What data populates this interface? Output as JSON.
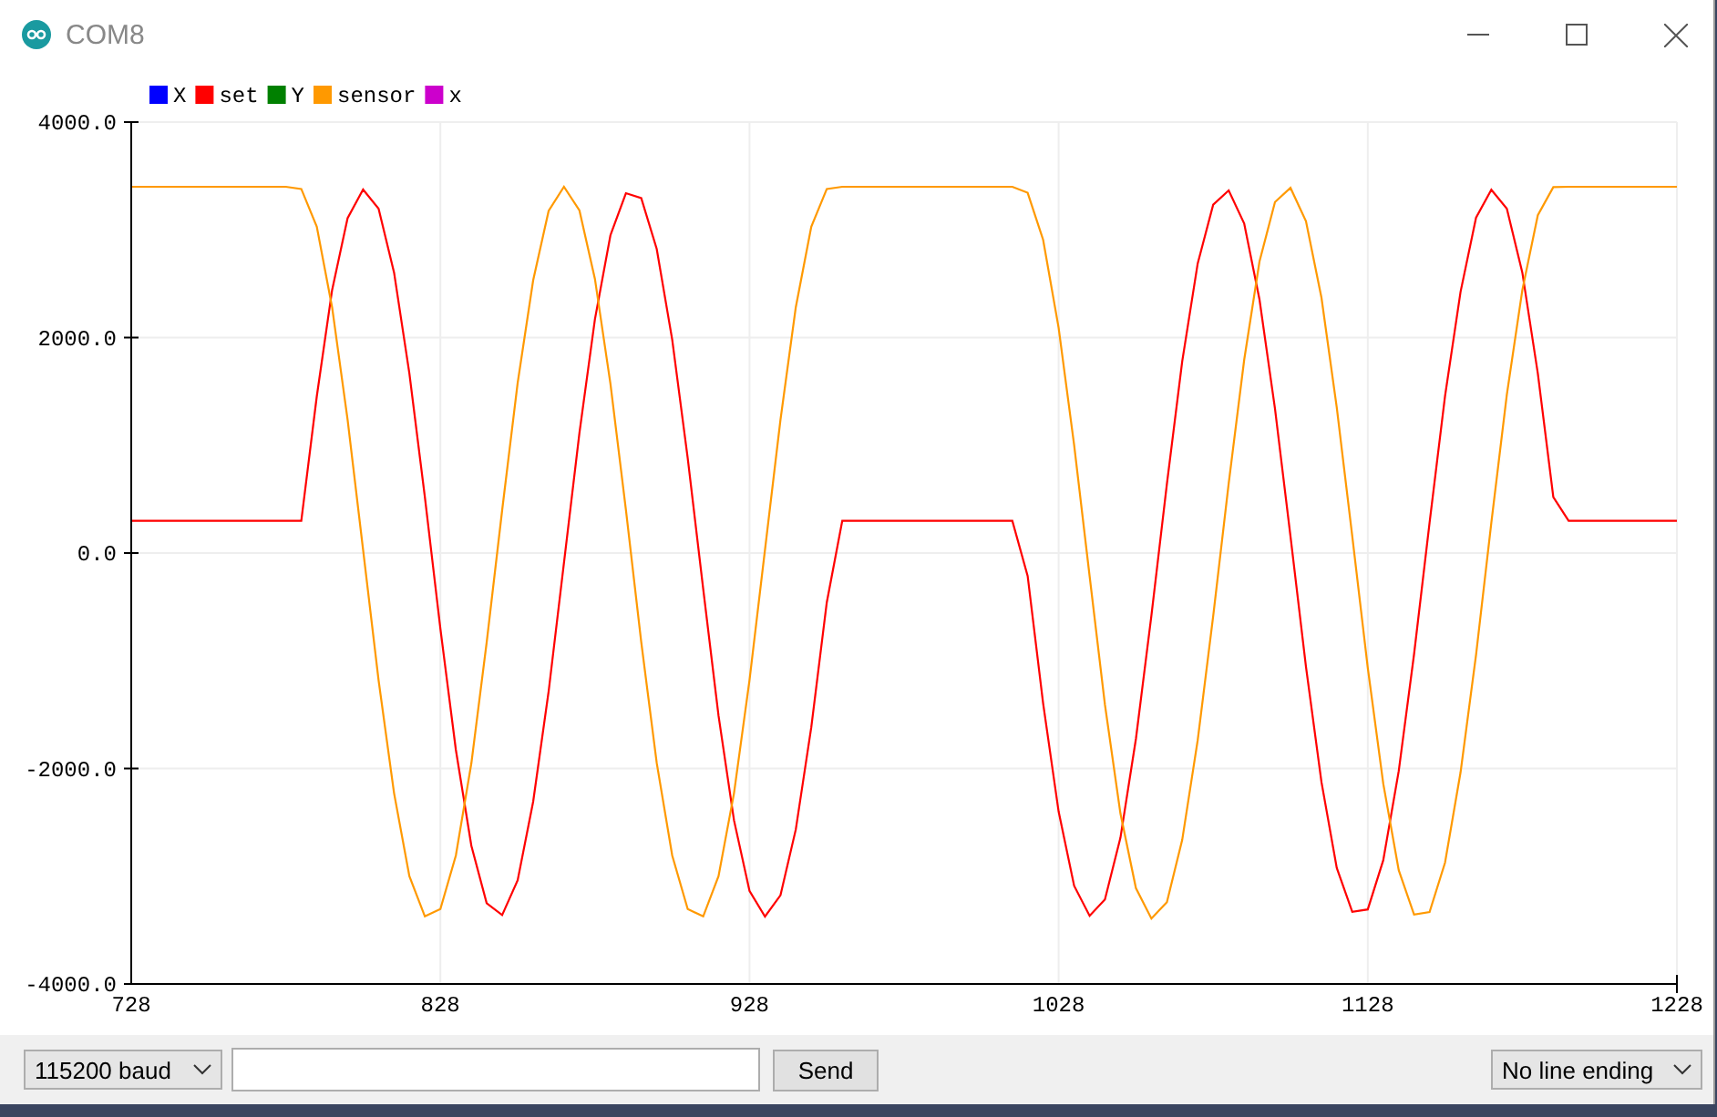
{
  "window": {
    "title": "COM8"
  },
  "plot": {
    "chart_data": {
      "type": "line",
      "grid": true,
      "legend": true,
      "xlim": [
        728,
        1228
      ],
      "ylim": [
        -4000,
        4000
      ],
      "xticks": [
        728,
        828,
        928,
        1028,
        1128,
        1228
      ],
      "yticks": [
        {
          "value": 4000,
          "label": "4000.0"
        },
        {
          "value": 2000,
          "label": "2000.0"
        },
        {
          "value": 0,
          "label": "0.0"
        },
        {
          "value": -2000,
          "label": "-2000.0"
        },
        {
          "value": -4000,
          "label": "-4000.0"
        }
      ],
      "x": [
        728,
        733,
        738,
        743,
        748,
        753,
        758,
        763,
        768,
        773,
        778,
        783,
        788,
        793,
        798,
        803,
        808,
        813,
        818,
        823,
        828,
        833,
        838,
        843,
        848,
        853,
        858,
        863,
        868,
        873,
        878,
        883,
        888,
        893,
        898,
        903,
        908,
        913,
        918,
        923,
        928,
        933,
        938,
        943,
        948,
        953,
        958,
        963,
        968,
        973,
        978,
        983,
        988,
        993,
        998,
        1003,
        1008,
        1013,
        1018,
        1023,
        1028,
        1033,
        1038,
        1043,
        1048,
        1053,
        1058,
        1063,
        1068,
        1073,
        1078,
        1083,
        1088,
        1093,
        1098,
        1103,
        1108,
        1113,
        1118,
        1123,
        1128,
        1133,
        1138,
        1143,
        1148,
        1153,
        1158,
        1163,
        1168,
        1173,
        1178,
        1183,
        1188,
        1193,
        1198,
        1203,
        1208,
        1213,
        1218,
        1223,
        1228
      ],
      "series": [
        {
          "name": "X",
          "color": "#0000ff",
          "values": [
            null,
            null,
            null,
            null,
            null,
            null,
            null,
            null,
            null,
            null,
            null,
            null,
            null,
            null,
            null,
            null,
            null,
            null,
            null,
            null,
            null,
            null,
            null,
            null,
            null,
            null,
            null,
            null,
            null,
            null,
            null,
            null,
            null,
            null,
            null,
            null,
            null,
            null,
            null,
            null,
            null,
            null,
            null,
            null,
            null,
            null,
            null,
            null,
            null,
            null,
            null,
            null,
            null,
            null,
            null,
            null,
            null,
            null,
            null,
            null,
            null,
            null,
            null,
            null,
            null,
            null,
            null,
            null,
            null,
            null,
            null,
            null,
            null,
            null,
            null,
            null,
            null,
            null,
            null,
            null,
            null,
            null,
            null,
            null,
            null,
            null,
            null,
            null,
            null,
            null,
            null,
            null,
            null,
            null,
            null,
            null,
            null,
            null,
            null,
            null,
            null
          ]
        },
        {
          "name": "set",
          "color": "#ff0000",
          "values": [
            300,
            300,
            300,
            300,
            300,
            300,
            300,
            300,
            300,
            300,
            300,
            300,
            1455,
            2440,
            3109,
            3375,
            3196,
            2603,
            1667,
            520,
            -701,
            -1826,
            -2717,
            -3250,
            -3361,
            -3038,
            -2308,
            -1283,
            -91,
            1114,
            2170,
            2950,
            3341,
            3294,
            2822,
            1981,
            881,
            -334,
            -1509,
            -2481,
            -3135,
            -3375,
            -3176,
            -2565,
            -1617,
            -459,
            300,
            300,
            300,
            300,
            300,
            300,
            300,
            300,
            300,
            300,
            300,
            300,
            -213,
            -1397,
            -2400,
            -3088,
            -3368,
            -3216,
            -2643,
            -1725,
            -580,
            641,
            1779,
            2687,
            3233,
            3366,
            3058,
            2352,
            1340,
            155,
            -1056,
            -2126,
            -2923,
            -3331,
            -3308,
            -2852,
            -2022,
            -938,
            280,
            1458,
            2423,
            3112,
            3372,
            3196,
            2603,
            1667,
            520,
            300,
            300,
            300,
            300,
            300,
            300,
            300,
            300
          ]
        },
        {
          "name": "Y",
          "color": "#008000",
          "values": [
            null,
            null,
            null,
            null,
            null,
            null,
            null,
            null,
            null,
            null,
            null,
            null,
            null,
            null,
            null,
            null,
            null,
            null,
            null,
            null,
            null,
            null,
            null,
            null,
            null,
            null,
            null,
            null,
            null,
            null,
            null,
            null,
            null,
            null,
            null,
            null,
            null,
            null,
            null,
            null,
            null,
            null,
            null,
            null,
            null,
            null,
            null,
            null,
            null,
            null,
            null,
            null,
            null,
            null,
            null,
            null,
            null,
            null,
            null,
            null,
            null,
            null,
            null,
            null,
            null,
            null,
            null,
            null,
            null,
            null,
            null,
            null,
            null,
            null,
            null,
            null,
            null,
            null,
            null,
            null,
            null,
            null,
            null,
            null,
            null,
            null,
            null,
            null,
            null,
            null,
            null,
            null,
            null,
            null,
            null,
            null,
            null,
            null,
            null,
            null,
            null
          ]
        },
        {
          "name": "sensor",
          "color": "#ff9900",
          "values": [
            3400,
            3400,
            3400,
            3400,
            3400,
            3400,
            3400,
            3400,
            3400,
            3400,
            3400,
            3380,
            3029,
            2281,
            1238,
            31,
            -1180,
            -2230,
            -2999,
            -3373,
            -3305,
            -2808,
            -1952,
            -830,
            398,
            1578,
            2530,
            3176,
            3400,
            3179,
            2543,
            1571,
            401,
            -826,
            -1948,
            -2808,
            -3305,
            -3373,
            -2999,
            -2230,
            -1180,
            31,
            1238,
            2281,
            3029,
            3380,
            3400,
            3400,
            3400,
            3400,
            3400,
            3400,
            3400,
            3400,
            3400,
            3400,
            3400,
            3400,
            3343,
            2907,
            2091,
            1003,
            -214,
            -1408,
            -2417,
            -3111,
            -3393,
            -3240,
            -2662,
            -1737,
            -585,
            646,
            1792,
            2706,
            3257,
            3390,
            3080,
            2370,
            1350,
            156,
            -1064,
            -2142,
            -2944,
            -3356,
            -3332,
            -2873,
            -2037,
            -945,
            282,
            1469,
            2441,
            3135,
            3397,
            3400,
            3400,
            3400,
            3400,
            3400,
            3400,
            3400,
            3400
          ]
        },
        {
          "name": "x",
          "color": "#cc00cc",
          "values": [
            null,
            null,
            null,
            null,
            null,
            null,
            null,
            null,
            null,
            null,
            null,
            null,
            null,
            null,
            null,
            null,
            null,
            null,
            null,
            null,
            null,
            null,
            null,
            null,
            null,
            null,
            null,
            null,
            null,
            null,
            null,
            null,
            null,
            null,
            null,
            null,
            null,
            null,
            null,
            null,
            null,
            null,
            null,
            null,
            null,
            null,
            null,
            null,
            null,
            null,
            null,
            null,
            null,
            null,
            null,
            null,
            null,
            null,
            null,
            null,
            null,
            null,
            null,
            null,
            null,
            null,
            null,
            null,
            null,
            null,
            null,
            null,
            null,
            null,
            null,
            null,
            null,
            null,
            null,
            null,
            null,
            null,
            null,
            null,
            null,
            null,
            null,
            null,
            null,
            null,
            null,
            null,
            null,
            null,
            null,
            null,
            null,
            null,
            null,
            null,
            null
          ]
        }
      ]
    }
  },
  "controls": {
    "baud": "115200 baud",
    "send": "Send",
    "line_ending": "No line ending"
  }
}
